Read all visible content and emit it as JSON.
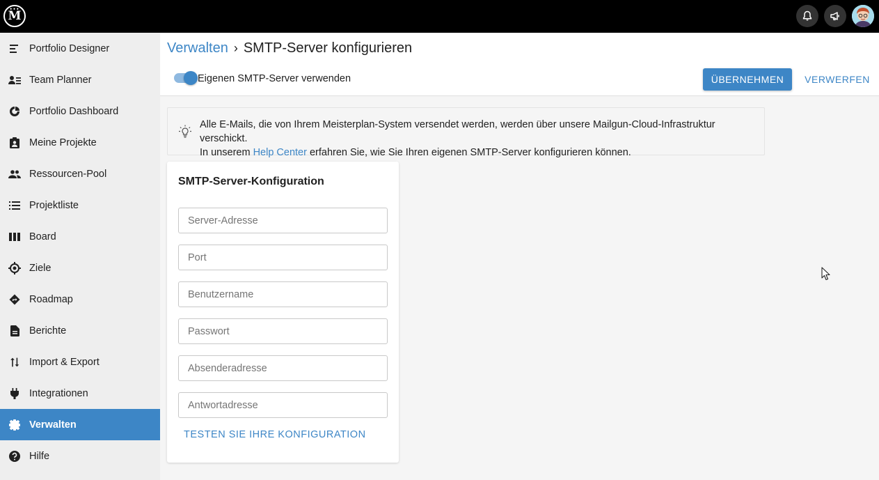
{
  "topbar": {
    "logo_text": "M",
    "icons": [
      "bell-icon",
      "megaphone-icon",
      "avatar"
    ]
  },
  "sidebar": {
    "items": [
      {
        "label": "Portfolio Designer",
        "icon": "portfolio-designer-icon"
      },
      {
        "label": "Team Planner",
        "icon": "team-planner-icon"
      },
      {
        "label": "Portfolio Dashboard",
        "icon": "dashboard-icon"
      },
      {
        "label": "Meine Projekte",
        "icon": "my-projects-icon"
      },
      {
        "label": "Ressourcen-Pool",
        "icon": "people-icon"
      },
      {
        "label": "Projektliste",
        "icon": "list-icon"
      },
      {
        "label": "Board",
        "icon": "board-icon"
      },
      {
        "label": "Ziele",
        "icon": "target-icon"
      },
      {
        "label": "Roadmap",
        "icon": "roadmap-icon"
      },
      {
        "label": "Berichte",
        "icon": "report-icon"
      },
      {
        "label": "Import & Export",
        "icon": "import-export-icon"
      },
      {
        "label": "Integrationen",
        "icon": "plug-icon"
      },
      {
        "label": "Verwalten",
        "icon": "gear-icon",
        "active": true
      },
      {
        "label": "Hilfe",
        "icon": "help-icon"
      }
    ]
  },
  "header": {
    "breadcrumb_parent": "Verwalten",
    "breadcrumb_separator": "›",
    "breadcrumb_current": "SMTP-Server konfigurieren",
    "toggle_label": "Eigenen SMTP-Server verwenden",
    "toggle_on": true,
    "apply_label": "ÜBERNEHMEN",
    "discard_label": "VERWERFEN"
  },
  "info": {
    "line1": "Alle E-Mails, die von Ihrem Meisterplan-System versendet werden, werden über unsere Mailgun-Cloud-Infrastruktur verschickt.",
    "line2_prefix": "In unserem ",
    "line2_link": "Help Center",
    "line2_suffix": " erfahren Sie, wie Sie Ihren eigenen SMTP-Server konfigurieren können."
  },
  "card": {
    "title": "SMTP-Server-Konfiguration",
    "fields": {
      "server": {
        "placeholder": "Server-Adresse",
        "value": ""
      },
      "port": {
        "placeholder": "Port",
        "value": ""
      },
      "username": {
        "placeholder": "Benutzername",
        "value": ""
      },
      "password": {
        "placeholder": "Passwort",
        "value": ""
      },
      "sender": {
        "placeholder": "Absenderadresse",
        "value": ""
      },
      "reply": {
        "placeholder": "Antwortadresse",
        "value": ""
      }
    },
    "test_label": "TESTEN SIE IHRE KONFIGURATION"
  },
  "colors": {
    "accent": "#3d86c6",
    "topbar": "#000000",
    "sidebar": "#eeeeee",
    "background": "#f5f5f5"
  }
}
